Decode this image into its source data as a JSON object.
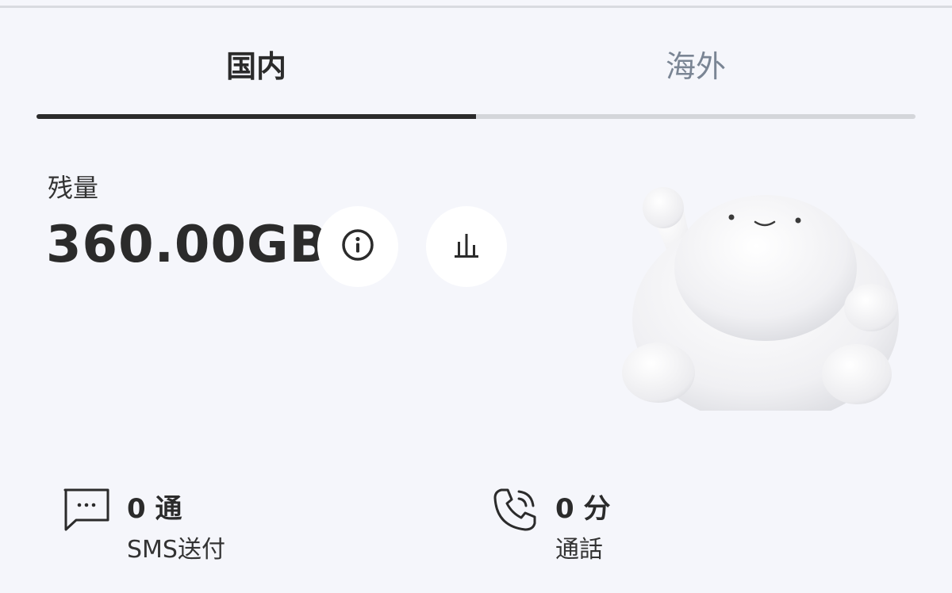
{
  "tabs": [
    {
      "label": "国内",
      "active": true
    },
    {
      "label": "海外",
      "active": false
    }
  ],
  "remaining": {
    "label": "残量",
    "value": "360.00GB"
  },
  "icons": {
    "info": "info-icon",
    "chart": "bar-chart-icon",
    "sms": "message-icon",
    "call": "phone-call-icon",
    "mascot": "mascot-illustration"
  },
  "stats": {
    "sms": {
      "value": "0 通",
      "label": "SMS送付"
    },
    "call": {
      "value": "0 分",
      "label": "通話"
    }
  },
  "colors": {
    "background": "#f5f6fb",
    "active_tab": "#2b2b2b",
    "inactive_tab": "#7a8594",
    "track": "#d4d6da"
  }
}
